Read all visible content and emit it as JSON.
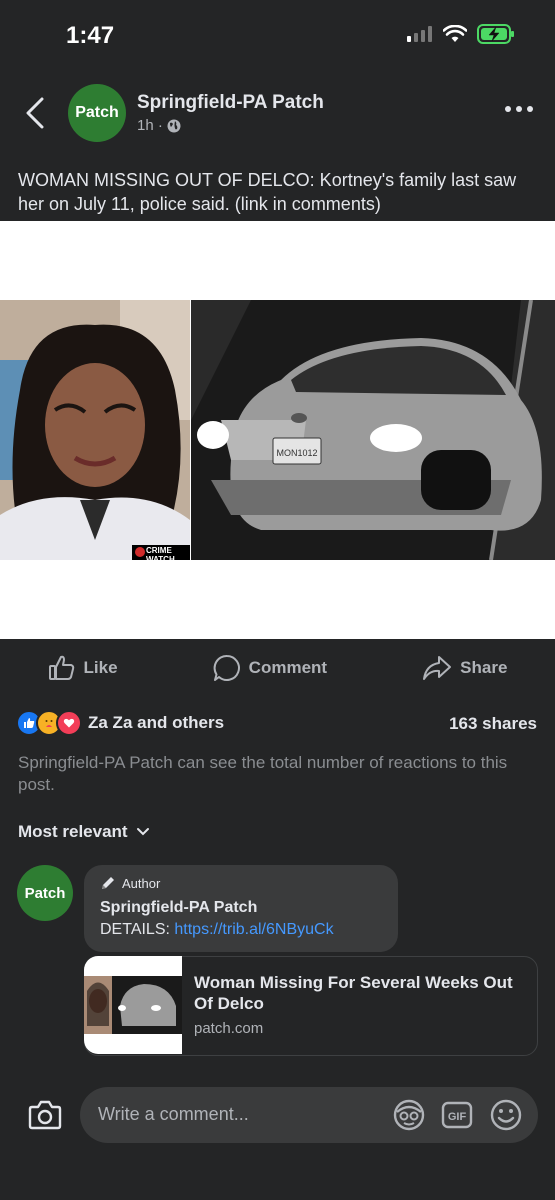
{
  "status_bar": {
    "time": "1:47"
  },
  "header": {
    "avatar_text": "Patch",
    "page_name": "Springfield-PA Patch",
    "time_ago": "1h ·"
  },
  "post": {
    "text": "WOMAN MISSING OUT OF DELCO: Kortney's family last saw her on July 11, police said. (link in comments)",
    "photo_watermark": "CRIME WATCH",
    "plate_text": "MON1012"
  },
  "actions": {
    "like": "Like",
    "comment": "Comment",
    "share": "Share"
  },
  "reactions": {
    "names": "Za Za and others",
    "shares": "163 shares",
    "note": "Springfield-PA Patch can see the total number of reactions to this post."
  },
  "sort": {
    "label": "Most relevant"
  },
  "comment": {
    "avatar_text": "Patch",
    "badge": "Author",
    "author": "Springfield-PA Patch",
    "text_prefix": "DETAILS: ",
    "link": "https://trib.al/6NByuCk"
  },
  "link_preview": {
    "title": "Woman Missing For Several Weeks Out Of Delco",
    "domain": "patch.com"
  },
  "composer": {
    "placeholder": "Write a comment..."
  },
  "colors": {
    "background": "#242526",
    "bubble": "#3a3b3c",
    "link": "#4599ff",
    "patch_green": "#2e7d32",
    "like_blue": "#1877f2",
    "love_red": "#f33e58"
  }
}
